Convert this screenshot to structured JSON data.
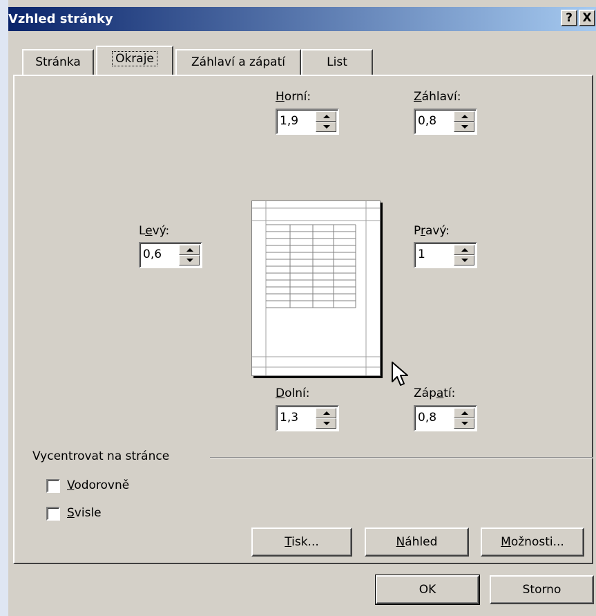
{
  "window": {
    "title": "Vzhled stránky",
    "help_button": "?",
    "close_button": "X"
  },
  "tabs": [
    {
      "label": "Stránka"
    },
    {
      "label": "Okraje",
      "active": true
    },
    {
      "label": "Záhlaví a zápatí"
    },
    {
      "label": "List"
    }
  ],
  "margins": {
    "top": {
      "label_ul": "H",
      "label_rest": "orní:",
      "value": "1,9"
    },
    "header": {
      "label_ul": "Z",
      "label_rest": "áhlaví:",
      "value": "0,8"
    },
    "left": {
      "label_pre": "L",
      "label_ul": "e",
      "label_rest": "vý:",
      "value": "0,6"
    },
    "right": {
      "label_pre": "P",
      "label_ul": "r",
      "label_rest": "avý:",
      "value": "1"
    },
    "bottom": {
      "label_ul": "D",
      "label_rest": "olní:",
      "value": "1,3"
    },
    "footer": {
      "label_pre": "Záp",
      "label_ul": "a",
      "label_rest": "tí:",
      "value": "0,8"
    }
  },
  "center_group": {
    "title": "Vycentrovat na stránce",
    "horizontal": {
      "label_ul": "V",
      "label_rest": "odorovně",
      "checked": false
    },
    "vertical": {
      "label_ul": "S",
      "label_rest": "visle",
      "checked": false
    }
  },
  "panel_buttons": {
    "print": {
      "label_ul": "T",
      "label_rest": "isk..."
    },
    "preview": {
      "label_ul": "N",
      "label_rest": "áhled"
    },
    "options": {
      "label_ul": "M",
      "label_rest": "ožnosti..."
    }
  },
  "dialog_buttons": {
    "ok": "OK",
    "cancel": "Storno"
  }
}
